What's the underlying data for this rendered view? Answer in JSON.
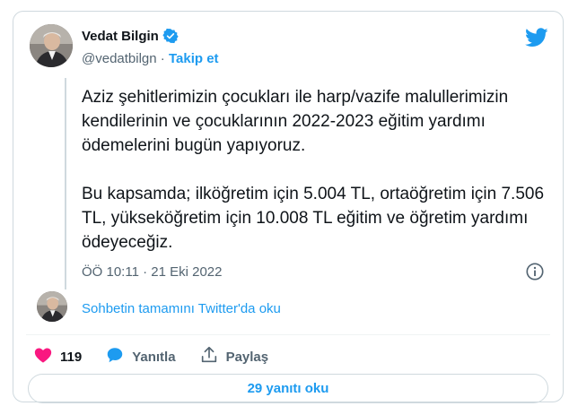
{
  "author": {
    "name": "Vedat Bilgin",
    "handle": "@vedatbilgn",
    "separator": "·",
    "follow_label": "Takip et"
  },
  "tweet": {
    "paragraphs": [
      "Aziz şehitlerimizin çocukları ile harp/vazife malullerimizin kendilerinin ve çocuklarının 2022-2023 eğitim yardımı ödemelerini bugün yapıyoruz.",
      "Bu kapsamda; ilköğretim için 5.004 TL, ortaöğretim için 7.506 TL, yükseköğretim için 10.008 TL eğitim ve öğretim yardımı ödeyeceğiz."
    ],
    "timestamp": "ÖÖ 10:11 · 21 Eki 2022"
  },
  "conversation": {
    "link_label": "Sohbetin tamamını Twitter'da oku"
  },
  "actions": {
    "like_count": "119",
    "reply_label": "Yanıtla",
    "share_label": "Paylaş"
  },
  "replies_button": {
    "label": "29 yanıtı oku"
  },
  "icons": {
    "verified": "verified-badge-icon",
    "brand": "twitter-bird-icon",
    "info": "info-icon",
    "like": "heart-icon",
    "reply": "speech-bubble-icon",
    "share": "share-upload-icon"
  },
  "colors": {
    "accent": "#1d9bf0",
    "like": "#f91880",
    "text": "#0f1419",
    "muted": "#536471",
    "border": "#cfd9de"
  }
}
